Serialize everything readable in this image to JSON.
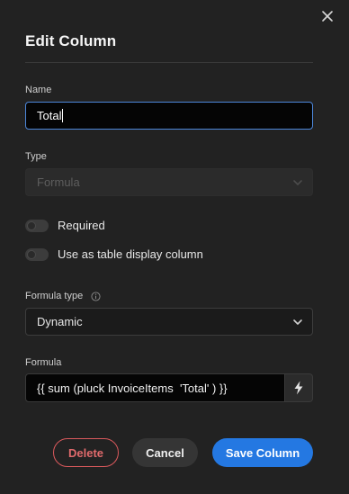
{
  "dialog": {
    "title": "Edit Column",
    "close_icon": "close-icon"
  },
  "fields": {
    "name_label": "Name",
    "name_value": "Total",
    "type_label": "Type",
    "type_value": "Formula",
    "required_label": "Required",
    "required_on": false,
    "display_column_label": "Use as table display column",
    "display_column_on": false,
    "formula_type_label": "Formula type",
    "formula_type_value": "Dynamic",
    "formula_label": "Formula",
    "formula_value": "{{ sum (pluck InvoiceItems  'Total' ) }}"
  },
  "actions": {
    "delete_label": "Delete",
    "cancel_label": "Cancel",
    "save_label": "Save Column"
  },
  "colors": {
    "background": "#222222",
    "accent": "#2478e2",
    "danger": "#d9595c",
    "focus_border": "#4c86d9"
  }
}
